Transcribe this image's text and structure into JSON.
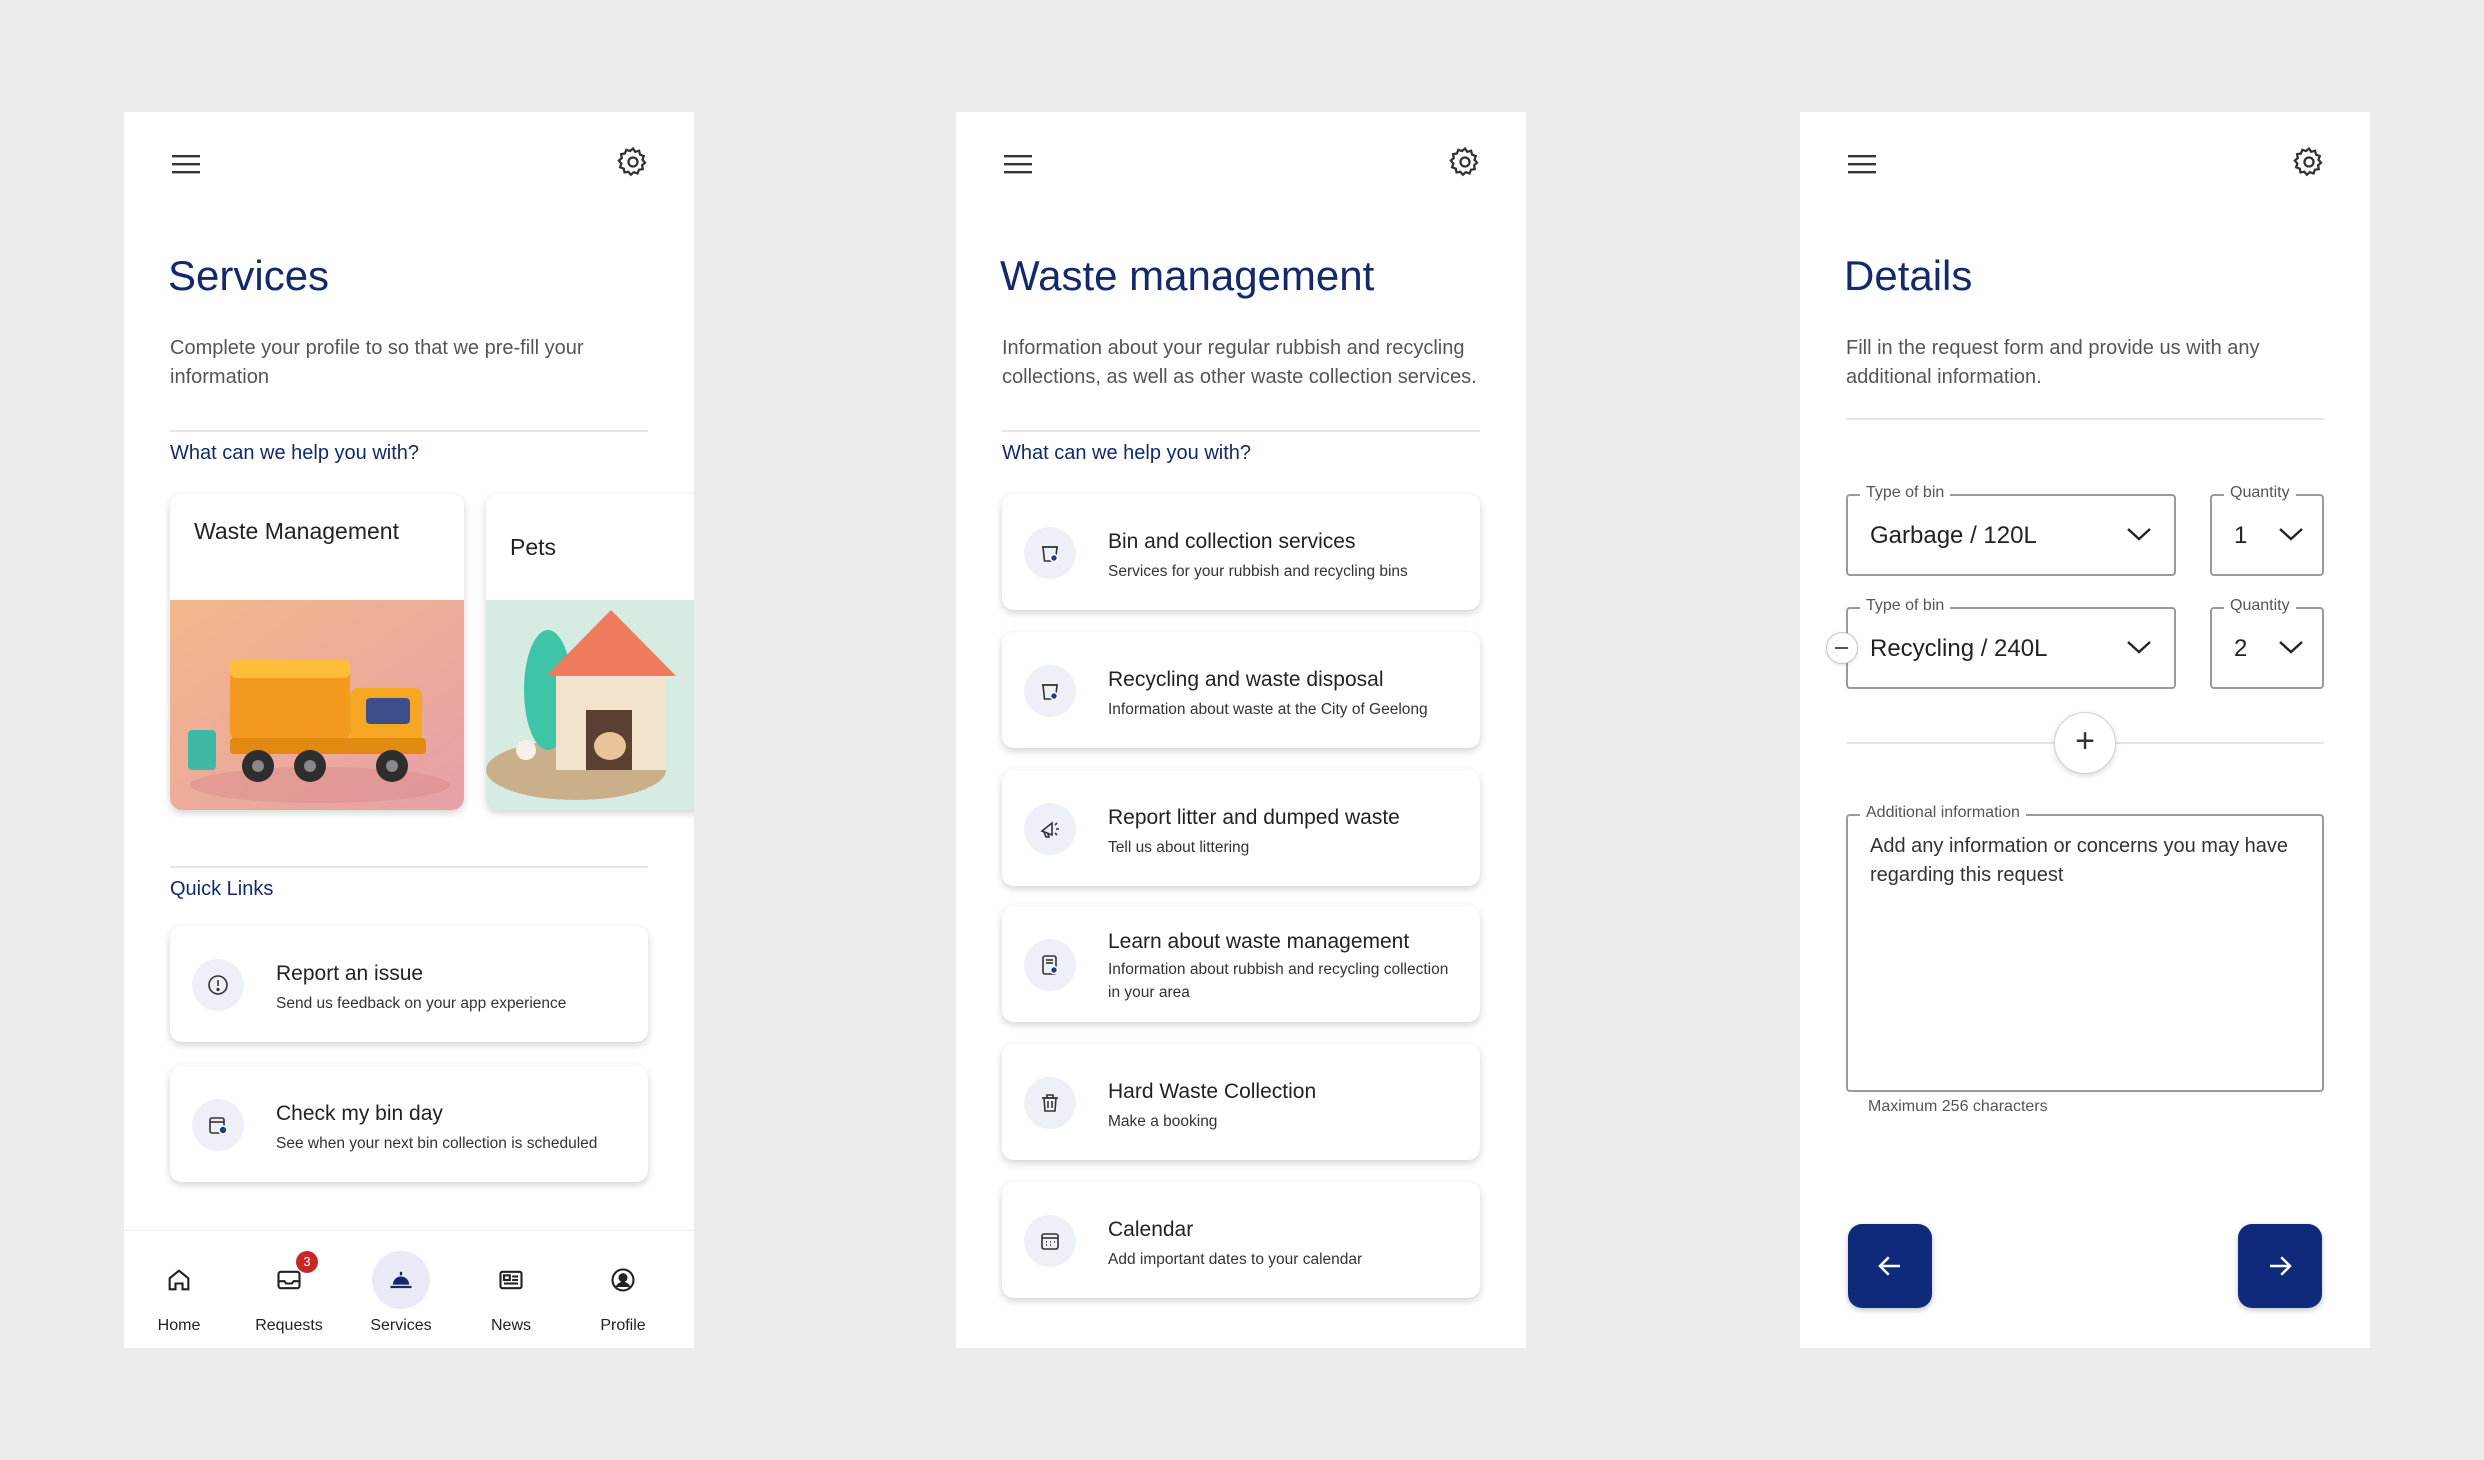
{
  "colors": {
    "brand": "#14296b",
    "accent": "#0f2a7a",
    "badge": "#c62828",
    "background": "#ececec",
    "card": "#ffffff"
  },
  "screen1": {
    "title": "Services",
    "description": "Complete your profile to so that we pre-fill your information",
    "help_label": "What can we help you with?",
    "service_cards": [
      {
        "title": "Waste Management",
        "image": "garbage-truck-illustration"
      },
      {
        "title": "Pets",
        "image": "dog-house-illustration"
      }
    ],
    "quick_links_label": "Quick Links",
    "quick_links": [
      {
        "title": "Report an issue",
        "subtitle": "Send us feedback on your app experience",
        "icon": "info-icon"
      },
      {
        "title": "Check my bin day",
        "subtitle": "See when your next bin collection is scheduled",
        "icon": "calendar-bin-icon"
      }
    ],
    "bottom_nav": [
      {
        "label": "Home",
        "icon": "home-icon"
      },
      {
        "label": "Requests",
        "icon": "inbox-icon",
        "badge": "3"
      },
      {
        "label": "Services",
        "icon": "service-bell-icon",
        "active": true
      },
      {
        "label": "News",
        "icon": "newspaper-icon"
      },
      {
        "label": "Profile",
        "icon": "profile-icon"
      }
    ]
  },
  "screen2": {
    "title": "Waste management",
    "description": "Information about your regular rubbish and recycling collections, as well as other waste collection services.",
    "help_label": "What can we help you with?",
    "items": [
      {
        "title": "Bin and collection services",
        "subtitle": "Services for your rubbish and recycling bins",
        "icon": "bin-settings-icon"
      },
      {
        "title": "Recycling and waste disposal",
        "subtitle": "Information about waste at the City of Geelong",
        "icon": "recycle-bin-icon"
      },
      {
        "title": "Report litter and dumped waste",
        "subtitle": "Tell us about littering",
        "icon": "megaphone-icon"
      },
      {
        "title": "Learn about waste management",
        "subtitle": "Information about rubbish and recycling collection in your area",
        "icon": "document-info-icon"
      },
      {
        "title": "Hard Waste Collection",
        "subtitle": "Make a booking",
        "icon": "trash-icon"
      },
      {
        "title": "Calendar",
        "subtitle": "Add important dates to your calendar",
        "icon": "calendar-icon"
      }
    ]
  },
  "screen3": {
    "title": "Details",
    "description": "Fill in the request form and provide us with any additional information.",
    "rows": [
      {
        "type_label": "Type of bin",
        "type_value": "Garbage / 120L",
        "qty_label": "Quantity",
        "qty_value": "1"
      },
      {
        "type_label": "Type of bin",
        "type_value": "Recycling / 240L",
        "qty_label": "Quantity",
        "qty_value": "2"
      }
    ],
    "add_symbol": "+",
    "additional_label": "Additional information",
    "additional_placeholder": "Add any information or concerns you may have regarding this request",
    "helper": "Maximum 256 characters"
  }
}
